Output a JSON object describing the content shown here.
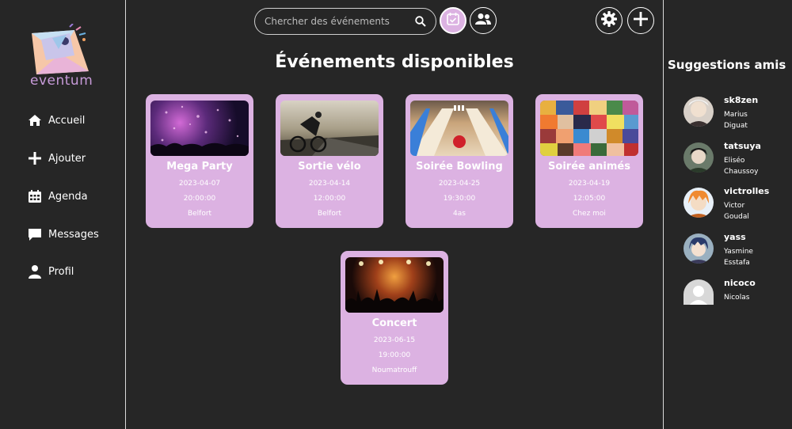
{
  "app": {
    "logo_text": "eventum"
  },
  "sidebar": {
    "items": [
      {
        "label": "Accueil",
        "icon": "home-icon"
      },
      {
        "label": "Ajouter",
        "icon": "plus-icon"
      },
      {
        "label": "Agenda",
        "icon": "calendar-icon"
      },
      {
        "label": "Messages",
        "icon": "message-icon"
      },
      {
        "label": "Profil",
        "icon": "user-icon"
      }
    ]
  },
  "header": {
    "search_placeholder": "Chercher des événements",
    "accent_color": "#dcb2e2"
  },
  "main": {
    "title": "Événements disponibles",
    "events": [
      {
        "title": "Mega Party",
        "date": "2023-04-07",
        "time": "20:00:00",
        "place": "Belfort"
      },
      {
        "title": "Sortie vélo",
        "date": "2023-04-14",
        "time": "12:00:00",
        "place": "Belfort"
      },
      {
        "title": "Soirée Bowling",
        "date": "2023-04-25",
        "time": "19:30:00",
        "place": "4as"
      },
      {
        "title": "Soirée animés",
        "date": "2023-04-19",
        "time": "12:05:00",
        "place": "Chez moi"
      },
      {
        "title": "Concert",
        "date": "2023-06-15",
        "time": "19:00:00",
        "place": "Noumatrouff"
      }
    ]
  },
  "suggestions": {
    "title": "Suggestions amis",
    "friends": [
      {
        "username": "sk8zen",
        "first": "Marius",
        "last": "Diguat"
      },
      {
        "username": "tatsuya",
        "first": "Eliséo",
        "last": "Chaussoy"
      },
      {
        "username": "victrolles",
        "first": "Victor",
        "last": "Goudal"
      },
      {
        "username": "yass",
        "first": "Yasmine",
        "last": "Esstafa"
      },
      {
        "username": "nicoco",
        "first": "Nicolas",
        "last": ""
      }
    ]
  }
}
